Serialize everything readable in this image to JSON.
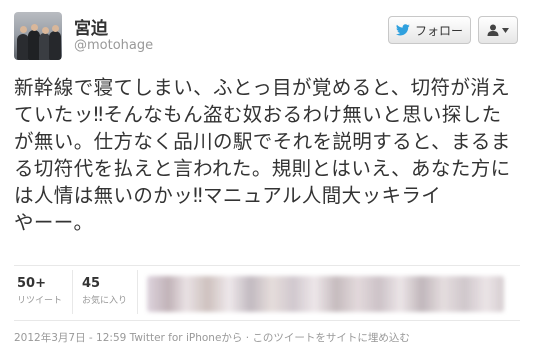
{
  "user": {
    "display_name": "宮迫",
    "handle": "@motohage"
  },
  "actions": {
    "follow_label": "フォロー",
    "follow_icon": "twitter-bird-icon",
    "user_menu_icon": "user-dropdown-icon"
  },
  "tweet": {
    "lines": [
      "新幹線で寝てしまい、ふとっ目が覚めると、切符が消え",
      "ていたッ‼そんなもん盗む奴おるわけ無いと思い探した",
      "が無い。仕方なく品川の駅でそれを説明すると、まるま",
      "る切符代を払えと言われた。規則とはいえ、あなた方に",
      "は人情は無いのかッ‼マニュアル人間大ッキライ",
      "やーー。"
    ]
  },
  "stats": {
    "retweets_count": "50+",
    "retweets_label": "リツイート",
    "favorites_count": "45",
    "favorites_label": "お気に入り"
  },
  "meta": {
    "timestamp": "2012年3月7日 - 12:59",
    "via": "Twitter for iPhoneから",
    "separator": "·",
    "embed_link": "このツイートをサイトに埋め込む"
  },
  "colors": {
    "text": "#333333",
    "muted": "#999999",
    "twitter_blue": "#2fa0de"
  }
}
